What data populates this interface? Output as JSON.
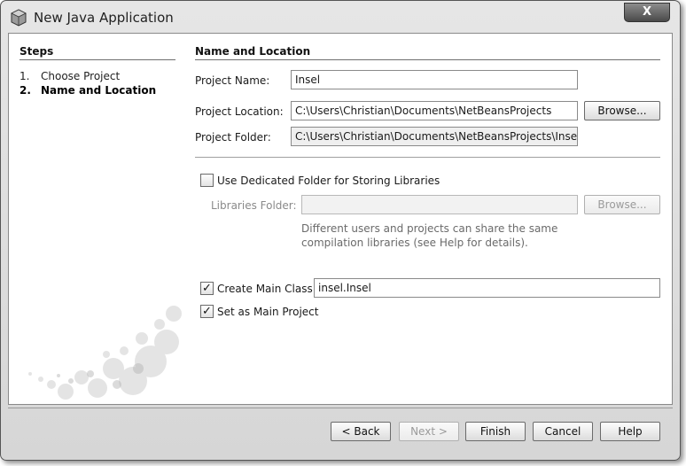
{
  "window": {
    "title": "New Java Application",
    "close_label": "X"
  },
  "steps": {
    "title": "Steps",
    "items": [
      {
        "num": "1.",
        "label": "Choose Project"
      },
      {
        "num": "2.",
        "label": "Name and Location"
      }
    ]
  },
  "form": {
    "section_title": "Name and Location",
    "project_name_label": "Project Name:",
    "project_name_value": "Insel",
    "project_location_label": "Project Location:",
    "project_location_value": "C:\\Users\\Christian\\Documents\\NetBeansProjects",
    "browse_label": "Browse...",
    "project_folder_label": "Project Folder:",
    "project_folder_value": "C:\\Users\\Christian\\Documents\\NetBeansProjects\\Insel",
    "dedicated_folder_label": "Use Dedicated Folder for Storing Libraries",
    "dedicated_folder_checked": false,
    "libraries_folder_label": "Libraries Folder:",
    "libraries_folder_value": "",
    "libraries_browse_label": "Browse...",
    "note_line1": "Different users and projects can share the same",
    "note_line2": "compilation libraries (see Help for details).",
    "create_main_class_label": "Create Main Class",
    "create_main_class_checked": true,
    "main_class_value": "insel.Insel",
    "set_main_project_label": "Set as Main Project",
    "set_main_project_checked": true,
    "check_mark": "✓"
  },
  "footer": {
    "back_label": "< Back",
    "next_label": "Next >",
    "finish_label": "Finish",
    "cancel_label": "Cancel",
    "help_label": "Help"
  }
}
